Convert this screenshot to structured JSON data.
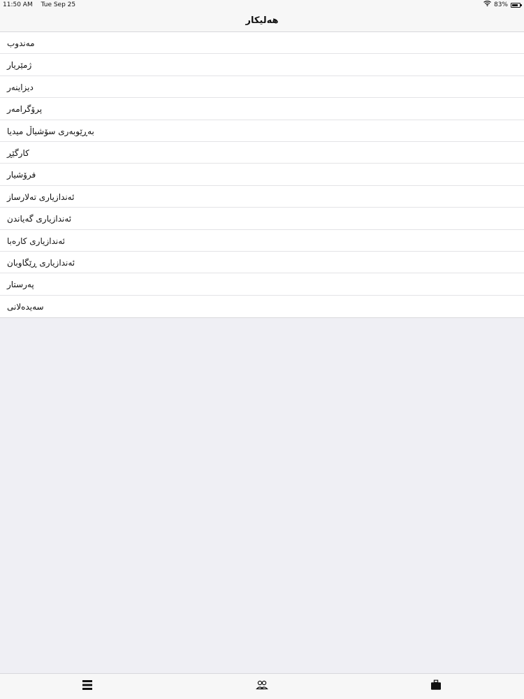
{
  "status_bar": {
    "time": "11:50 AM",
    "date": "Tue Sep 25",
    "battery": "83%",
    "battery_level": 0.83
  },
  "nav": {
    "title": "هەلیکار"
  },
  "list": {
    "items": [
      {
        "label": "مەندوب"
      },
      {
        "label": "ژمێریار"
      },
      {
        "label": "دیزاینەر"
      },
      {
        "label": "پرۆگرامەر"
      },
      {
        "label": "بەڕێوبەری سۆشیاڵ میدیا"
      },
      {
        "label": "کارگێڕ"
      },
      {
        "label": "فرۆشیار"
      },
      {
        "label": "ئەندازیاری تەلارساز"
      },
      {
        "label": "ئەندازیاری گەیاندن"
      },
      {
        "label": "ئەندازیاری کارەبا"
      },
      {
        "label": "ئەندازیاری ڕێگاوبان"
      },
      {
        "label": "پەرستار"
      },
      {
        "label": "سەیدەلانی"
      }
    ]
  },
  "tab_bar": {
    "tabs": [
      {
        "icon": "list-icon"
      },
      {
        "icon": "people-icon"
      },
      {
        "icon": "briefcase-icon"
      }
    ]
  }
}
